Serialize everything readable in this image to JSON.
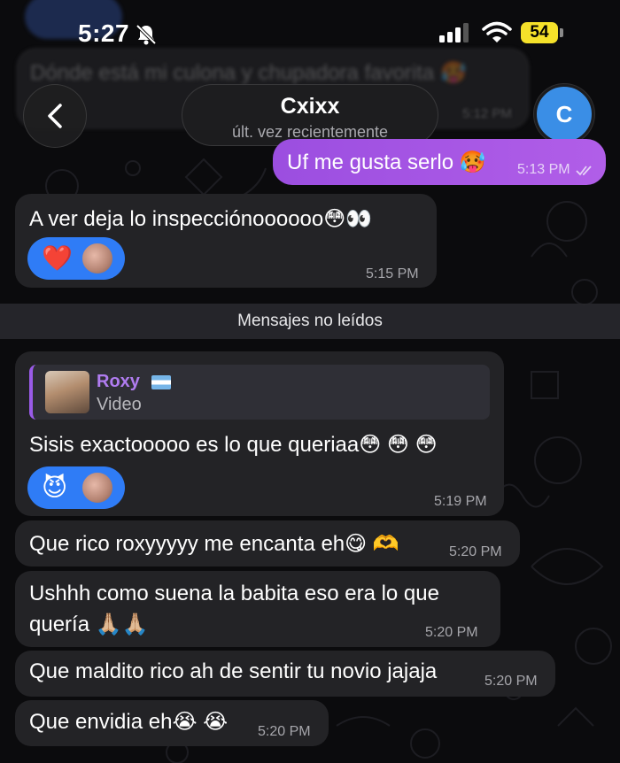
{
  "status_bar": {
    "time": "5:27",
    "battery": "54"
  },
  "header": {
    "back_label": "‹",
    "title": "Cxixx",
    "subtitle": "últ. vez recientemente",
    "avatar_letter": "C"
  },
  "background_message": {
    "text": "Dónde está mi culona y chupadora favorita 🥵",
    "time": "5:12 PM"
  },
  "messages": [
    {
      "direction": "out",
      "text": "Uf me gusta serlo 🥵",
      "time": "5:13 PM",
      "read": true
    },
    {
      "direction": "in",
      "text": "A ver deja lo inspecciónoooooo😳👀",
      "time": "5:15 PM",
      "reaction": "❤️"
    },
    {
      "direction": "in",
      "text": "Sisis exactooooo es lo que queriaa😳 😳 😳",
      "time": "5:19 PM",
      "reaction": "😈",
      "reply": {
        "name": "Roxy",
        "flag": "🇦🇷",
        "type": "Video"
      }
    },
    {
      "direction": "in",
      "text": "Que rico roxyyyyy me encanta eh😋 🫶",
      "time": "5:20 PM"
    },
    {
      "direction": "in",
      "text_line1": "Ushhh como suena la babita eso era lo que",
      "text_line2": "quería 🙏🏼🙏🏼",
      "time": "5:20 PM"
    },
    {
      "direction": "in",
      "text": "Que maldito rico ah de sentir tu novio jajaja",
      "time": "5:20 PM"
    },
    {
      "direction": "in",
      "text": "Que envidia eh😭 😭",
      "time": "5:20 PM"
    }
  ],
  "unread_divider": "Mensajes no leídos",
  "colors": {
    "outgoing": "#a855e6",
    "incoming": "#232326",
    "reaction": "#2f7cf6",
    "accent": "#9a5be8"
  }
}
